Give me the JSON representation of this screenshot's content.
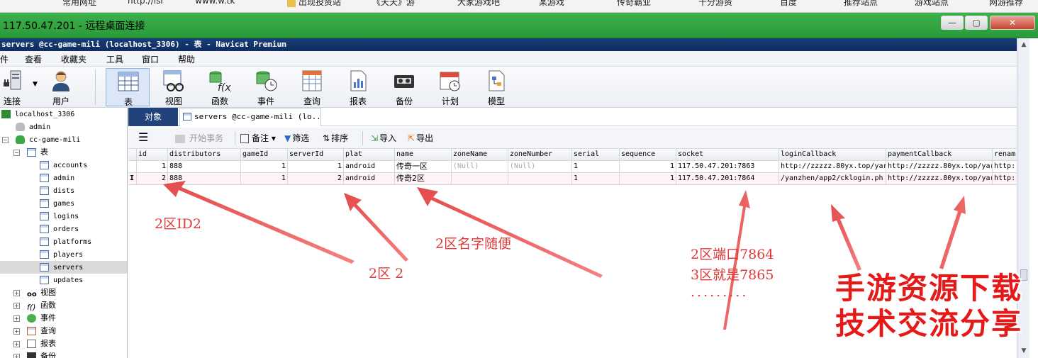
{
  "browser_bookmarks": [
    "常用网址",
    "http://lsr",
    "www.w.tk",
    "出现投资站",
    "《天天》游",
    "大家游戏吧",
    "某游戏",
    "传奇霸业",
    "十分游资",
    "百度",
    "推荐站点",
    "游戏站点",
    "网游推荐"
  ],
  "rdp": {
    "title": "117.50.47.201 - 远程桌面连接",
    "min": "—",
    "max": "▢",
    "close": "✕"
  },
  "navicat": {
    "title": "servers @cc-game-mili (localhost_3306) - 表 - Navicat Premium"
  },
  "menu": [
    "件",
    "查看",
    "收藏夹",
    "工具",
    "窗口",
    "帮助"
  ],
  "toolbar": [
    {
      "label": "连接",
      "icon": "connection-icon"
    },
    {
      "label": "用户",
      "icon": "user-icon"
    },
    {
      "label": "表",
      "icon": "table-icon"
    },
    {
      "label": "视图",
      "icon": "view-icon"
    },
    {
      "label": "函数",
      "icon": "function-icon"
    },
    {
      "label": "事件",
      "icon": "event-icon"
    },
    {
      "label": "查询",
      "icon": "query-icon"
    },
    {
      "label": "报表",
      "icon": "report-icon"
    },
    {
      "label": "备份",
      "icon": "backup-icon"
    },
    {
      "label": "计划",
      "icon": "schedule-icon"
    },
    {
      "label": "模型",
      "icon": "model-icon"
    }
  ],
  "sidebar": {
    "connection": "localhost_3306",
    "dbs": [
      "admin",
      "cc-game-mili"
    ],
    "tables_label": "表",
    "tables": [
      "accounts",
      "admin",
      "dists",
      "games",
      "logins",
      "orders",
      "platforms",
      "players",
      "servers",
      "updates"
    ],
    "groups": [
      "视图",
      "函数",
      "事件",
      "查询",
      "报表",
      "备份"
    ]
  },
  "tabs": {
    "objects": "对象",
    "servers": "servers @cc-game-mili (lo..."
  },
  "data_toolbar": {
    "menu": "☰",
    "begin_tx": "开始事务",
    "note": "备注",
    "filter": "筛选",
    "sort": "排序",
    "import": "导入",
    "export": "导出"
  },
  "grid": {
    "columns": [
      "id",
      "distributors",
      "gameId",
      "serverId",
      "plat",
      "name",
      "zoneName",
      "zoneNumber",
      "serial",
      "sequence",
      "socket",
      "loginCallback",
      "paymentCallback",
      "renam"
    ],
    "rows": [
      [
        "1",
        "888",
        "1",
        "1",
        "android",
        "传奇一区",
        "(Null)",
        "(Null)",
        "1",
        "1",
        "117.50.47.201:7863",
        "http://zzzzz.80yx.top/yar",
        "http://zzzzz.80yx.top/yar",
        "http:"
      ],
      [
        "2",
        "888",
        "1",
        "2",
        "android",
        "传奇2区",
        "",
        "",
        "1",
        "1",
        "117.50.47.201:7864",
        "/yanzhen/app2/cklogin.ph",
        "http://zzzzz.80yx.top/yar",
        "http:"
      ]
    ],
    "row_marker": "I"
  },
  "annotations": {
    "a1": "2区ID2",
    "a2": "2区 2",
    "a3": "2区名字随便",
    "a4": "2区端口7864",
    "a5": "3区就是7865",
    "a6": ".........",
    "watermark_1": "手游资源下载",
    "watermark_2": "技术交流分享"
  },
  "colors": {
    "rdp_green": "#2fa640",
    "navicat_title": "#183e79",
    "tab_selected": "#21427a",
    "annotation_red": "#e03a3a",
    "watermark_red": "#e61919"
  }
}
